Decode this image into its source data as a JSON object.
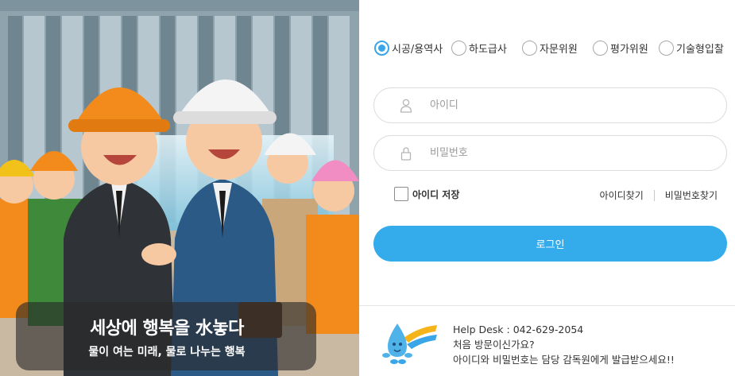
{
  "hero": {
    "title": "세상에 행복을 水놓다",
    "subtitle": "물이 여는 미래, 물로 나누는 행복"
  },
  "login": {
    "user_types": [
      {
        "label": "시공/용역사",
        "selected": true
      },
      {
        "label": "하도급사",
        "selected": false
      },
      {
        "label": "자문위원",
        "selected": false
      },
      {
        "label": "평가위원",
        "selected": false
      },
      {
        "label": "기술형입찰",
        "selected": false
      }
    ],
    "id_placeholder": "아이디",
    "pw_placeholder": "비밀번호",
    "save_id_label": "아이디 저장",
    "save_id_checked": false,
    "find_id_label": "아이디찾기",
    "find_pw_label": "비밀번호찾기",
    "login_button": "로그인",
    "accent_color": "#34acec"
  },
  "help": {
    "line1": "Help Desk : 042-629-2054",
    "line2": "처음 방문이신가요?",
    "line3": "아이디와 비밀번호는 담당 감독원에게 발급받으세요!!"
  },
  "icons": [
    "user-icon",
    "lock-icon",
    "water-mascot-icon"
  ]
}
